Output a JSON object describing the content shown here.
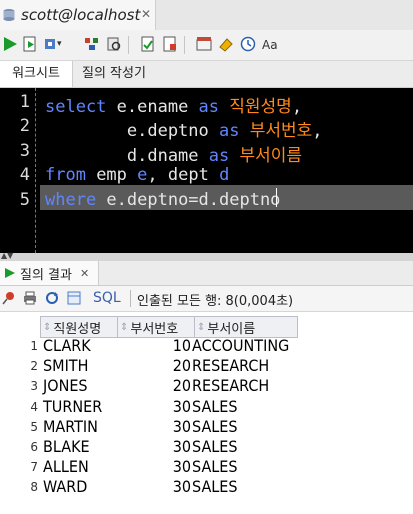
{
  "window": {
    "connection_tab": "scott@localhost"
  },
  "subtabs": [
    "워크시트",
    "질의 작성기"
  ],
  "editor": {
    "lines": [
      {
        "n": "1",
        "tokens": [
          [
            "kw",
            "select "
          ],
          [
            "id",
            "e.ename "
          ],
          [
            "kw",
            "as "
          ],
          [
            "ko",
            "직원성명"
          ],
          [
            "op",
            ","
          ]
        ]
      },
      {
        "n": "2",
        "tokens": [
          [
            "id",
            "        e.deptno "
          ],
          [
            "kw",
            "as "
          ],
          [
            "ko",
            "부서번호"
          ],
          [
            "op",
            ","
          ]
        ]
      },
      {
        "n": "3",
        "tokens": [
          [
            "id",
            "        d.dname "
          ],
          [
            "kw",
            "as "
          ],
          [
            "ko",
            "부서이름"
          ]
        ]
      },
      {
        "n": "4",
        "tokens": [
          [
            "kw",
            "from "
          ],
          [
            "id",
            "emp "
          ],
          [
            "kw",
            "e"
          ],
          [
            "op",
            ", "
          ],
          [
            "id",
            "dept "
          ],
          [
            "kw",
            "d"
          ]
        ]
      },
      {
        "n": "5",
        "tokens": [
          [
            "kw",
            "where "
          ],
          [
            "id",
            "e.deptno=d.deptno"
          ]
        ]
      }
    ]
  },
  "results": {
    "tab_label": "질의 결과",
    "sql_label": "SQL",
    "status": "인출된 모든 행: 8(0,004초)",
    "columns": [
      "직원성명",
      "부서번호",
      "부서이름"
    ],
    "rows": [
      {
        "n": "1",
        "ename": "CLARK",
        "deptno": "10",
        "dname": "ACCOUNTING"
      },
      {
        "n": "2",
        "ename": "SMITH",
        "deptno": "20",
        "dname": "RESEARCH"
      },
      {
        "n": "3",
        "ename": "JONES",
        "deptno": "20",
        "dname": "RESEARCH"
      },
      {
        "n": "4",
        "ename": "TURNER",
        "deptno": "30",
        "dname": "SALES"
      },
      {
        "n": "5",
        "ename": "MARTIN",
        "deptno": "30",
        "dname": "SALES"
      },
      {
        "n": "6",
        "ename": "BLAKE",
        "deptno": "30",
        "dname": "SALES"
      },
      {
        "n": "7",
        "ename": "ALLEN",
        "deptno": "30",
        "dname": "SALES"
      },
      {
        "n": "8",
        "ename": "WARD",
        "deptno": "30",
        "dname": "SALES"
      }
    ]
  }
}
